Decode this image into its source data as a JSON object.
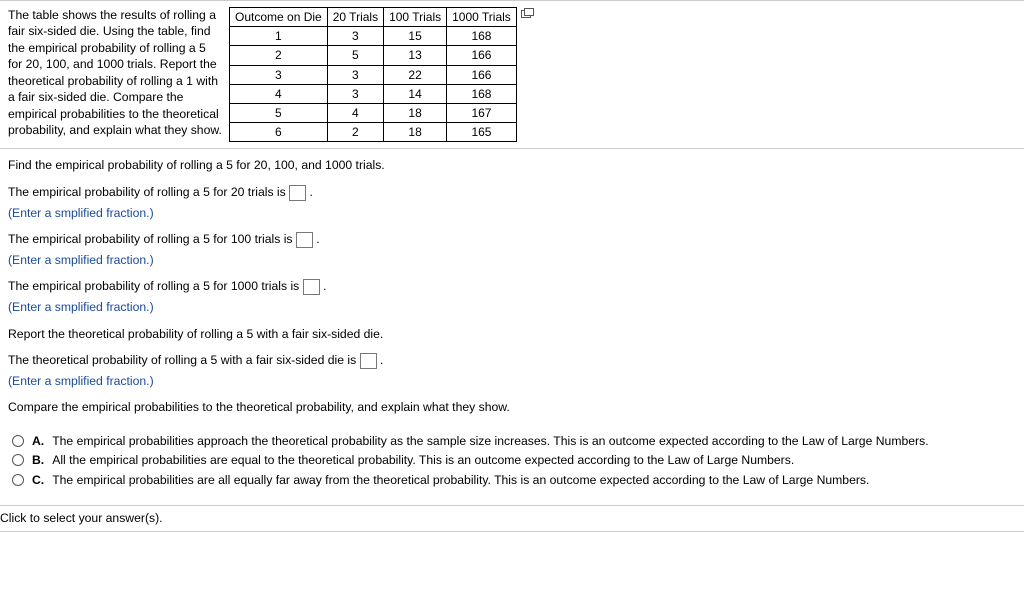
{
  "intro_text": "The table shows the results of rolling a fair six-sided die. Using the table, find the empirical probability of rolling a 5 for 20, 100, and 1000 trials. Report the theoretical probability of rolling a 1 with a fair six-sided die. Compare the empirical probabilities to the theoretical probability, and explain what they show.",
  "table": {
    "headers": [
      "Outcome on Die",
      "20 Trials",
      "100 Trials",
      "1000 Trials"
    ],
    "rows": [
      [
        "1",
        "3",
        "15",
        "168"
      ],
      [
        "2",
        "5",
        "13",
        "166"
      ],
      [
        "3",
        "3",
        "22",
        "166"
      ],
      [
        "4",
        "3",
        "14",
        "168"
      ],
      [
        "5",
        "4",
        "18",
        "167"
      ],
      [
        "6",
        "2",
        "18",
        "165"
      ]
    ]
  },
  "q1_prompt": "Find the empirical probability of rolling a 5 for 20, 100, and 1000 trials.",
  "l20_a": "The empirical probability of rolling a 5 for 20 trials is ",
  "l20_b": " .",
  "hint": "(Enter a smplified fraction.)",
  "l100_a": "The empirical probability of rolling a 5 for 100 trials is ",
  "l100_b": " .",
  "l1000_a": "The empirical probability of rolling a 5 for 1000 trials is ",
  "l1000_b": " .",
  "q2_prompt": "Report the theoretical probability of rolling a 5 with a fair six-sided die.",
  "lth_a": "The theoretical probability of rolling a 5 with a fair six-sided die is ",
  "lth_b": " .",
  "q3_prompt": "Compare the empirical probabilities to the theoretical probability, and explain what they show.",
  "options": [
    {
      "letter": "A.",
      "text": "The empirical probabilities approach the theoretical probability as the sample size increases. This is an outcome expected according to the Law of Large Numbers."
    },
    {
      "letter": "B.",
      "text": "All the empirical probabilities are equal to the theoretical probability. This is an outcome expected according to the Law of Large Numbers."
    },
    {
      "letter": "C.",
      "text": "The empirical probabilities are all equally far away from the theoretical probability. This is an outcome expected according to the Law of Large Numbers."
    }
  ],
  "footer": "Click to select your answer(s).",
  "chart_data": {
    "type": "table",
    "title": "Die roll outcomes by number of trials",
    "columns": [
      "Outcome on Die",
      "20 Trials",
      "100 Trials",
      "1000 Trials"
    ],
    "rows": [
      [
        1,
        3,
        15,
        168
      ],
      [
        2,
        5,
        13,
        166
      ],
      [
        3,
        3,
        22,
        166
      ],
      [
        4,
        3,
        14,
        168
      ],
      [
        5,
        4,
        18,
        167
      ],
      [
        6,
        2,
        18,
        165
      ]
    ]
  }
}
